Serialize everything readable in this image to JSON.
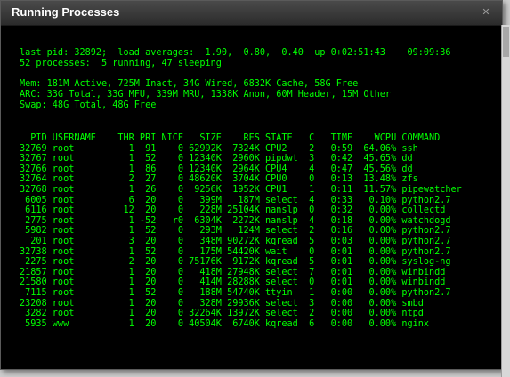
{
  "window": {
    "title": "Running Processes",
    "close_glyph": "✕"
  },
  "terminal": {
    "color": "#00ff00",
    "summary": {
      "line1": "last pid: 32892;  load averages:  1.90,  0.80,  0.40  up 0+02:51:43    09:09:36",
      "line2": "52 processes:  5 running, 47 sleeping",
      "mem": "Mem: 181M Active, 725M Inact, 34G Wired, 6832K Cache, 58G Free",
      "arc": "ARC: 33G Total, 33G MFU, 339M MRU, 1338K Anon, 60M Header, 15M Other",
      "swap": "Swap: 48G Total, 48G Free"
    },
    "header": "  PID USERNAME    THR PRI NICE   SIZE    RES STATE   C   TIME    WCPU COMMAND",
    "processes": [
      "32769 root          1  91    0 62992K  7324K CPU2    2   0:59  64.06% ssh",
      "32767 root          1  52    0 12340K  2960K pipdwt  3   0:42  45.65% dd",
      "32766 root          1  86    0 12340K  2964K CPU4    4   0:47  45.56% dd",
      "32764 root          2  27    0 48620K  3704K CPU0    0   0:13  13.48% zfs",
      "32768 root          1  26    0  9256K  1952K CPU1    1   0:11  11.57% pipewatcher",
      " 6005 root          6  20    0   399M   187M select  4   0:33   0.10% python2.7",
      " 6116 root         12  20    0   228M 25104K nanslp  0   0:32   0.00% collectd",
      " 2775 root          1 -52   r0  6304K  2272K nanslp  4   0:18   0.00% watchdogd",
      " 5982 root          1  52    0   293M   124M select  2   0:16   0.00% python2.7",
      "  201 root          3  20    0   348M 90272K kqread  5   0:03   0.00% python2.7",
      "32738 root          1  52    0   175M 54420K wait    0   0:01   0.00% python2.7",
      " 2275 root          2  20    0 75176K  9172K kqread  5   0:01   0.00% syslog-ng",
      "21857 root          1  20    0   418M 27948K select  7   0:01   0.00% winbindd",
      "21580 root          1  20    0   414M 28288K select  0   0:01   0.00% winbindd",
      " 7115 root          1  52    0   188M 54740K ttyin   1   0:00   0.00% python2.7",
      "23208 root          1  20    0   328M 29936K select  3   0:00   0.00% smbd",
      " 3282 root          1  20    0 32264K 13972K select  2   0:00   0.00% ntpd",
      " 5935 www           1  20    0 40504K  6740K kqread  6   0:00   0.00% nginx"
    ]
  }
}
